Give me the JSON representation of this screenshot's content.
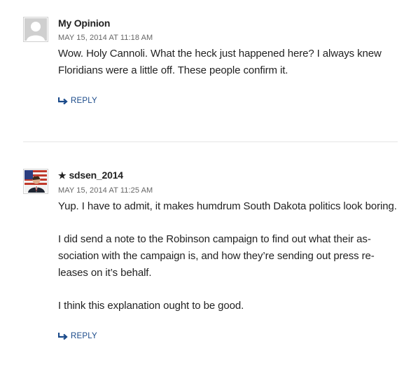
{
  "comments": [
    {
      "author": "My Opinion",
      "date": "MAY 15, 2014 AT 11:18 AM",
      "paragraphs": [
        "Wow. Holy Cannoli. What the heck just happened here? I always knew Floridians were a little off. These people confirm it."
      ],
      "reply_label": "REPLY",
      "avatar": "default-gray-avatar"
    },
    {
      "author_badge": "★",
      "author": "sdsen_2014",
      "date": "MAY 15, 2014 AT 11:25 AM",
      "paragraphs": [
        "Yup. I have to admit, it makes humdrum South Dakota politics look boring.",
        "I did send a note to the Robinson campaign to find out what their as­sociation with the campaign is, and how they’re sending out press re­leases on it’s behalf.",
        "I think this explanation ought to be good."
      ],
      "reply_label": "REPLY",
      "avatar": "user-photo-avatar-flag"
    }
  ],
  "colors": {
    "link": "#1a4a8a",
    "meta": "#666666",
    "text": "#222222",
    "divider": "#e6e6e6"
  },
  "icons": {
    "reply": "reply-arrow-icon"
  }
}
